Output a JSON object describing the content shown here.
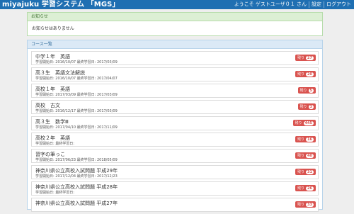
{
  "header": {
    "brand": "miyajuku 学習システム 「MGS」",
    "welcome": "ようこそ ゲストユーザ０１ さん",
    "settings": "設定",
    "logout": "ログアウト"
  },
  "notice": {
    "title": "お知らせ",
    "body": "お知らせはありません"
  },
  "courses": {
    "title": "コース一覧",
    "remain_label": "残り",
    "items": [
      {
        "title": "中学１年　英語",
        "meta": "学習開始日: 2016/10/07 最終学習日: 2017/03/09",
        "count": "27"
      },
      {
        "title": "高３生　英語文法解説",
        "meta": "学習開始日: 2016/10/07 最終学習日: 2017/04/07",
        "count": "20"
      },
      {
        "title": "高校１年　英語",
        "meta": "学習開始日: 2017/03/09 最終学習日: 2017/03/09",
        "count": "5"
      },
      {
        "title": "高校　古文",
        "meta": "学習開始日: 2016/12/17 最終学習日: 2017/03/09",
        "count": "3"
      },
      {
        "title": "高３生　数学Ⅲ",
        "meta": "学習開始日: 2017/04/10 最終学習日: 2017/11/09",
        "count": "445"
      },
      {
        "title": "高校２年　英語",
        "meta": "学習開始日: 最終学習日:",
        "count": "16"
      },
      {
        "title": "習字の筆っこ",
        "meta": "学習開始日: 2017/06/23 最終学習日: 2018/05/09",
        "count": "40"
      },
      {
        "title": "神奈川県公立高校入試問題 平成29年",
        "meta": "学習開始日: 2017/12/04 最終学習日: 2017/12/23",
        "count": "31"
      },
      {
        "title": "神奈川県公立高校入試問題 平成28年",
        "meta": "学習開始日: 最終学習日:",
        "count": "26"
      },
      {
        "title": "神奈川県公立高校入試問題 平成27年",
        "meta": "",
        "count": "33"
      }
    ]
  },
  "colors": {
    "navbar": "#1f6fb2",
    "remain_button": "#d9534f"
  }
}
